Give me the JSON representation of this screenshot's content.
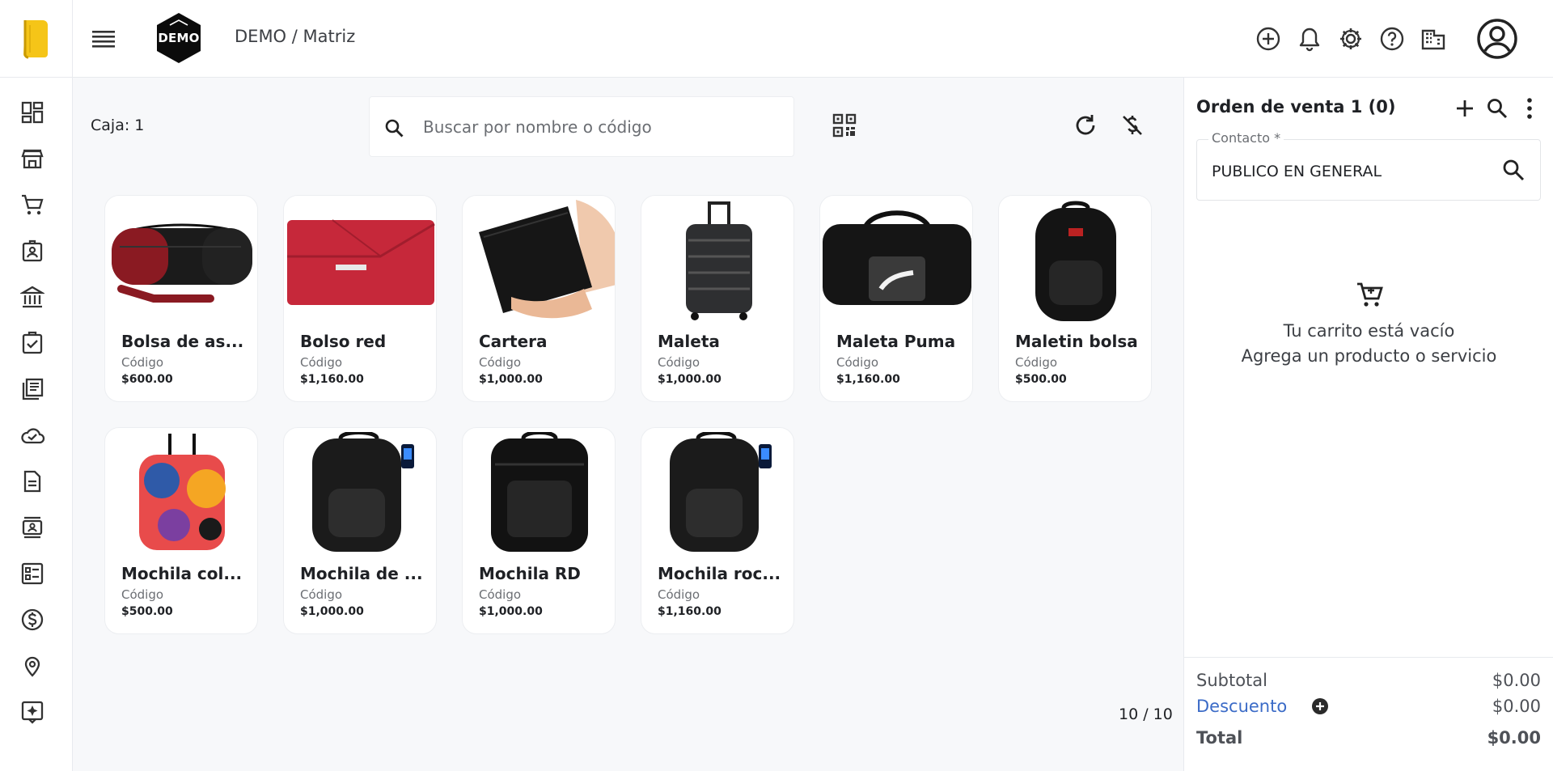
{
  "header": {
    "brand_badge": "DEMO",
    "breadcrumb": "DEMO / Matriz",
    "icons": [
      "add-circle-icon",
      "bell-icon",
      "gear-icon",
      "help-icon",
      "building-icon",
      "account-icon"
    ]
  },
  "sidebar": {
    "items": [
      "dashboard-icon",
      "store-icon",
      "cart-icon",
      "badge-icon",
      "bank-icon",
      "checklist-icon",
      "catalog-icon",
      "cloud-check-icon",
      "document-icon",
      "contacts-icon",
      "form-list-icon",
      "dollar-circle-icon",
      "location-pin-icon",
      "sparkle-icon"
    ]
  },
  "main": {
    "caja": "Caja: 1",
    "search_placeholder": "Buscar por nombre o código",
    "pager": "10 / 10",
    "products": [
      {
        "name": "Bolsa de as...",
        "code": "Código",
        "price": "$600.00"
      },
      {
        "name": "Bolso red",
        "code": "Código",
        "price": "$1,160.00"
      },
      {
        "name": "Cartera",
        "code": "Código",
        "price": "$1,000.00"
      },
      {
        "name": "Maleta",
        "code": "Código",
        "price": "$1,000.00"
      },
      {
        "name": "Maleta Puma",
        "code": "Código",
        "price": "$1,160.00"
      },
      {
        "name": "Maletin bolsa",
        "code": "Código",
        "price": "$500.00"
      },
      {
        "name": "Mochila col...",
        "code": "Código",
        "price": "$500.00"
      },
      {
        "name": "Mochila de ...",
        "code": "Código",
        "price": "$1,000.00"
      },
      {
        "name": "Mochila RD",
        "code": "Código",
        "price": "$1,000.00"
      },
      {
        "name": "Mochila roc...",
        "code": "Código",
        "price": "$1,160.00"
      }
    ]
  },
  "panel": {
    "title": "Orden de venta 1 (0)",
    "contact_label": "Contacto *",
    "contact_value": "PUBLICO EN GENERAL",
    "empty_line1": "Tu carrito está vacío",
    "empty_line2": "Agrega un producto o servicio",
    "subtotal_label": "Subtotal",
    "subtotal_value": "$0.00",
    "discount_label": "Descuento",
    "discount_value": "$0.00",
    "total_label": "Total",
    "total_value": "$0.00"
  },
  "colors": {
    "accent_yellow": "#f5c518",
    "link_blue": "#3b6bc7",
    "text": "#1f2125"
  }
}
